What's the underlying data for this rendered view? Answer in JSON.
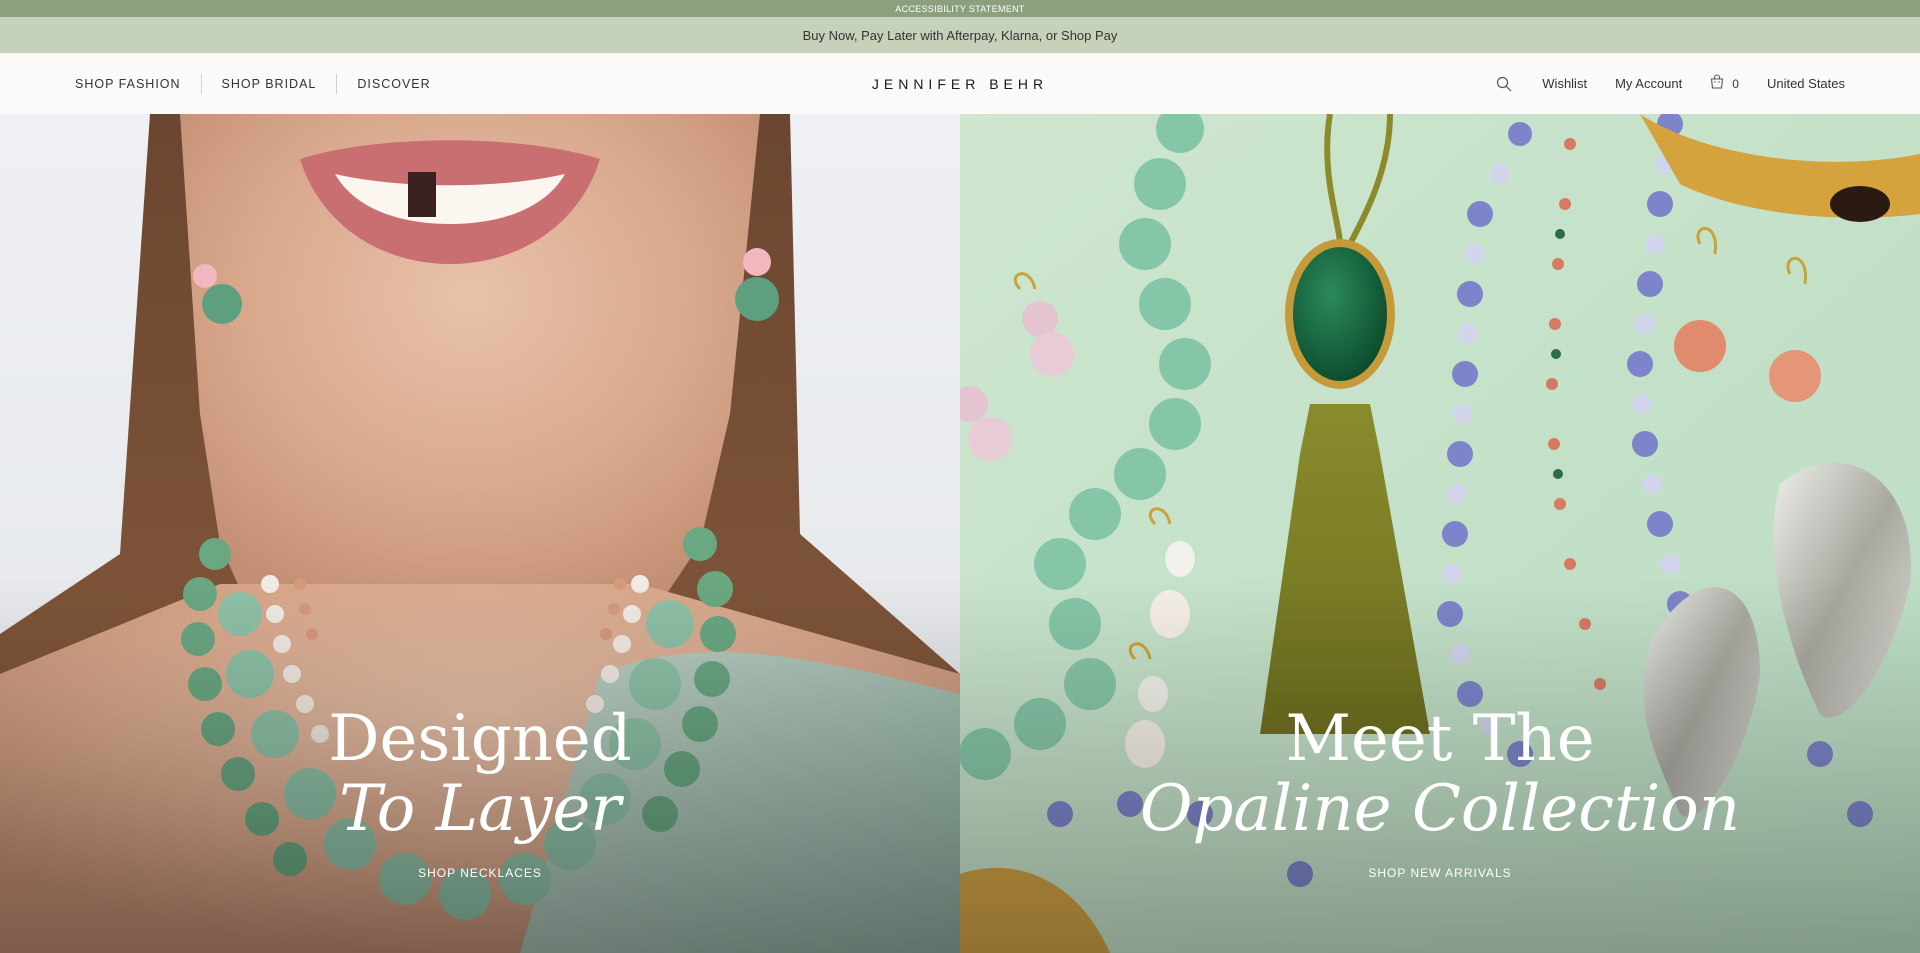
{
  "accessibility": {
    "label": "ACCESSIBILITY STATEMENT"
  },
  "promo": {
    "text": "Buy Now, Pay Later with Afterpay, Klarna, or Shop Pay"
  },
  "header": {
    "nav": [
      "SHOP FASHION",
      "SHOP BRIDAL",
      "DISCOVER"
    ],
    "logo": "JENNIFER BEHR",
    "wishlist": "Wishlist",
    "account": "My Account",
    "cart_count": "0",
    "region": "United States",
    "icons": [
      "search-icon",
      "shopping-bag-icon"
    ]
  },
  "hero": {
    "left": {
      "line1": "Designed",
      "line2": "To Layer",
      "cta": "SHOP NECKLACES"
    },
    "right": {
      "line1": "Meet The",
      "line2": "Opaline Collection",
      "cta": "SHOP NEW ARRIVALS"
    }
  },
  "colors": {
    "accessibility_bar": "#8da07e",
    "promo_bar": "#c6d1ba",
    "header_bg": "#fbfaf8"
  }
}
